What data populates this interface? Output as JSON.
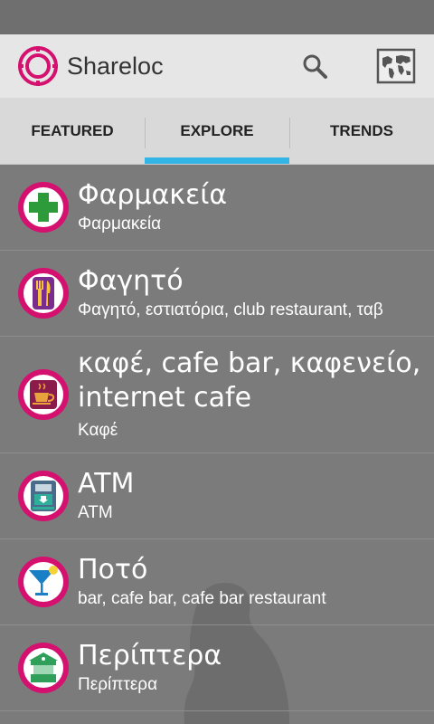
{
  "app": {
    "title": "Shareloc"
  },
  "icons": {
    "logo": "shareloc-target-logo-icon",
    "search": "search-icon",
    "map": "world-map-icon"
  },
  "colors": {
    "accent_tab": "#33b5e5",
    "brand_pink": "#d4116f"
  },
  "tabs": [
    {
      "label": "FEATURED",
      "selected": false
    },
    {
      "label": "EXPLORE",
      "selected": true
    },
    {
      "label": "TRENDS",
      "selected": false
    }
  ],
  "categories": [
    {
      "title": "Φαρμακεία",
      "subtitle": "Φαρμακεία",
      "icon": "pharmacy-cross-icon"
    },
    {
      "title": "Φαγητό",
      "subtitle": "Φαγητό, εστιατόρια, club restaurant, ταβ",
      "icon": "fork-knife-icon"
    },
    {
      "title": "καφέ, cafe bar, καφενείο, internet cafe",
      "subtitle": "Καφέ",
      "icon": "coffee-cup-icon"
    },
    {
      "title": "ATM",
      "subtitle": "ATM",
      "icon": "atm-machine-icon"
    },
    {
      "title": "Ποτό",
      "subtitle": "bar, cafe bar, cafe bar restaurant",
      "icon": "cocktail-glass-icon"
    },
    {
      "title": "Περίπτερα",
      "subtitle": "Περίπτερα",
      "icon": "kiosk-icon"
    }
  ]
}
